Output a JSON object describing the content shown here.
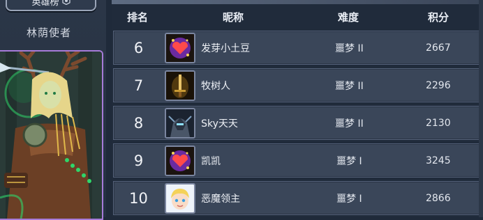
{
  "panel": {
    "tab_label": "英雄榜",
    "hero_name": "林荫使者"
  },
  "table": {
    "headers": {
      "rank": "排名",
      "name": "昵称",
      "difficulty": "难度",
      "score": "积分"
    },
    "rows": [
      {
        "rank": "6",
        "name": "发芽小土豆",
        "difficulty": "噩梦 II",
        "score": "2667",
        "avatar": "heart-gem-icon"
      },
      {
        "rank": "7",
        "name": "牧树人",
        "difficulty": "噩梦 II",
        "score": "2296",
        "avatar": "sword-icon"
      },
      {
        "rank": "8",
        "name": "Sky天天",
        "difficulty": "噩梦 II",
        "score": "2130",
        "avatar": "armored-knight-icon"
      },
      {
        "rank": "9",
        "name": "凯凯",
        "difficulty": "噩梦 I",
        "score": "3245",
        "avatar": "heart-gem-icon"
      },
      {
        "rank": "10",
        "name": "恶魔领主",
        "difficulty": "噩梦 I",
        "score": "2866",
        "avatar": "blonde-face-icon"
      }
    ]
  },
  "colors": {
    "accent_border": "#a77bd9",
    "row_bg": "#3a4659",
    "page_bg": "#1f2a3a"
  }
}
